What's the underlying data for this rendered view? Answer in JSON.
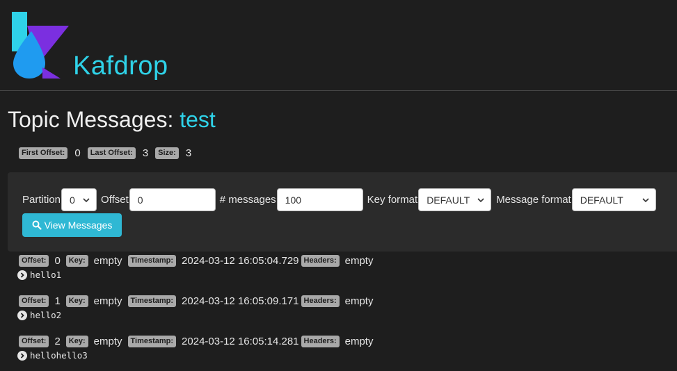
{
  "header": {
    "brand": "Kafdrop"
  },
  "title": {
    "prefix": "Topic Messages:",
    "topic": "test"
  },
  "stats": {
    "first_offset_label": "First Offset:",
    "first_offset": "0",
    "last_offset_label": "Last Offset:",
    "last_offset": "3",
    "size_label": "Size:",
    "size": "3"
  },
  "filter": {
    "partition_label": "Partition",
    "partition_value": "0",
    "offset_label": "Offset",
    "offset_value": "0",
    "messages_label": "# messages",
    "messages_value": "100",
    "key_format_label": "Key format",
    "key_format_value": "DEFAULT",
    "message_format_label": "Message format",
    "message_format_value": "DEFAULT",
    "view_button": "View Messages"
  },
  "labels": {
    "offset": "Offset:",
    "key": "Key:",
    "timestamp": "Timestamp:",
    "headers": "Headers:"
  },
  "messages": [
    {
      "offset": "0",
      "key": "empty",
      "timestamp": "2024-03-12 16:05:04.729",
      "headers": "empty",
      "payload": "hello1"
    },
    {
      "offset": "1",
      "key": "empty",
      "timestamp": "2024-03-12 16:05:09.171",
      "headers": "empty",
      "payload": "hello2"
    },
    {
      "offset": "2",
      "key": "empty",
      "timestamp": "2024-03-12 16:05:14.281",
      "headers": "empty",
      "payload": "hellohello3"
    }
  ],
  "colors": {
    "accent": "#2fd2e8",
    "button": "#2fb8d4",
    "logo_blue": "#1f9bf0",
    "logo_purple": "#7b2fe0"
  }
}
